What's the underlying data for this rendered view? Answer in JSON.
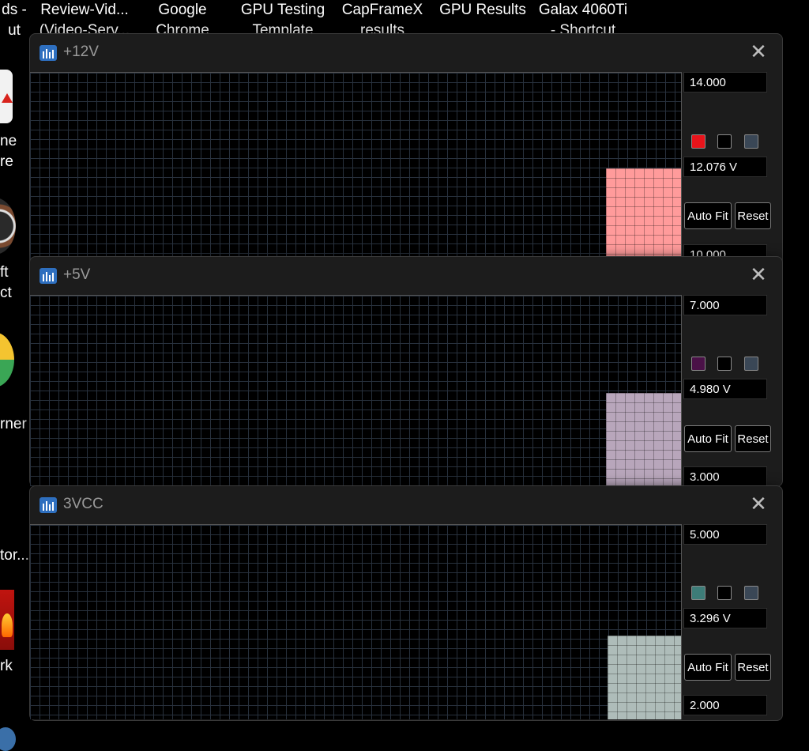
{
  "desktop": {
    "top_labels": [
      {
        "line1": "ds -",
        "line2": "ut"
      },
      {
        "line1": "Review-Vid...",
        "line2": "(Video-Serv..."
      },
      {
        "line1": "Google",
        "line2": "Chrome"
      },
      {
        "line1": "GPU Testing",
        "line2": "Template"
      },
      {
        "line1": "CapFrameX",
        "line2": "results"
      },
      {
        "line1": "GPU Results",
        "line2": ""
      },
      {
        "line1": "Galax 4060Ti",
        "line2": "- Shortcut"
      }
    ],
    "side_labels": [
      "ne",
      "re",
      "ft",
      "ct",
      "rner",
      "tor...",
      "rk"
    ]
  },
  "windows": [
    {
      "title": "+12V",
      "max": "14.000",
      "current": "12.076 V",
      "min": "10.000",
      "color": "#ff9b9b",
      "swatch_color": "#e8141b",
      "level": 0.52
    },
    {
      "title": "+5V",
      "max": "7.000",
      "current": "4.980 V",
      "min": "3.000",
      "color": "#b8a6bb",
      "swatch_color": "#4a1147",
      "level": 0.49
    },
    {
      "title": "3VCC",
      "max": "5.000",
      "current": "3.296 V",
      "min": "2.000",
      "color": "#aebcb9",
      "swatch_color": "#3d7c78",
      "level": 0.43
    }
  ],
  "buttons": {
    "auto_fit": "Auto Fit",
    "reset": "Reset"
  },
  "colors": {
    "grid": "#28313d",
    "background": "#000000",
    "swatch_bg": "#3a4756"
  }
}
